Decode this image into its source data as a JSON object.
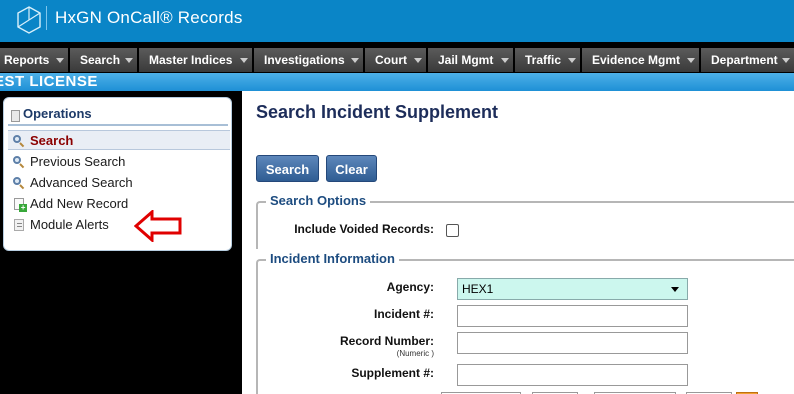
{
  "app": {
    "title": "HxGN OnCall® Records",
    "logo_icon": "hexagon-logo-icon",
    "brand_color": "#0a85c7"
  },
  "menu": {
    "items": [
      {
        "label": "Reports"
      },
      {
        "label": "Search"
      },
      {
        "label": "Master Indices"
      },
      {
        "label": "Investigations"
      },
      {
        "label": "Court"
      },
      {
        "label": "Jail Mgmt"
      },
      {
        "label": "Traffic"
      },
      {
        "label": "Evidence Mgmt"
      },
      {
        "label": "Department"
      }
    ]
  },
  "license": {
    "text": "EST LICENSE"
  },
  "operations": {
    "title": "Operations",
    "items": [
      {
        "label": "Search",
        "icon": "magnifier-icon",
        "active": true
      },
      {
        "label": "Previous Search",
        "icon": "magnifier-icon"
      },
      {
        "label": "Advanced Search",
        "icon": "magnifier-icon"
      },
      {
        "label": "Add New Record",
        "icon": "add-document-icon"
      },
      {
        "label": "Module Alerts",
        "icon": "document-icon"
      }
    ]
  },
  "annotation": {
    "icon": "red-arrow-icon",
    "color": "#e00000"
  },
  "main": {
    "title": "Search Incident Supplement",
    "buttons": {
      "search": "Search",
      "clear": "Clear"
    },
    "search_options": {
      "legend": "Search Options",
      "include_voided_label": "Include Voided Records:",
      "include_voided_checked": false
    },
    "incident_info": {
      "legend": "Incident Information",
      "agency_label": "Agency:",
      "agency_value": "HEX1",
      "incident_label": "Incident #:",
      "incident_value": "",
      "record_number_label": "Record Number:",
      "record_number_hint": "(Numeric )",
      "record_number_value": "",
      "supplement_label": "Supplement #:",
      "supplement_value": ""
    }
  }
}
